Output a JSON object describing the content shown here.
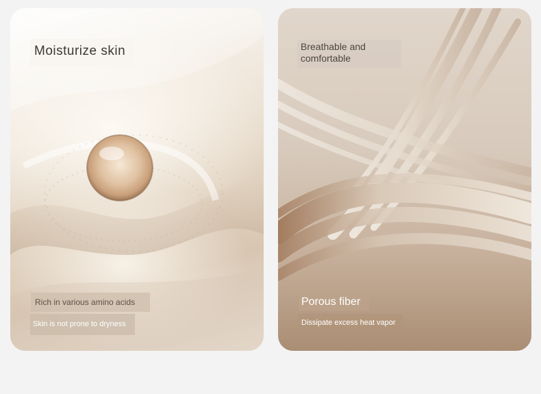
{
  "left_card": {
    "title": "Moisturize skin",
    "line1": "Rich in various amino acids",
    "line2": "Skin is not prone to dryness",
    "image": "silk-fabric-with-water-droplet"
  },
  "right_card": {
    "title": "Breathable and comfortable",
    "line1": "Porous fiber",
    "line2": "Dissipate excess heat vapor",
    "image": "hair-fiber-strands"
  },
  "colors": {
    "background": "#f3f3f3",
    "left_tone": "#e2d4c2",
    "right_tone": "#aa8e74"
  }
}
